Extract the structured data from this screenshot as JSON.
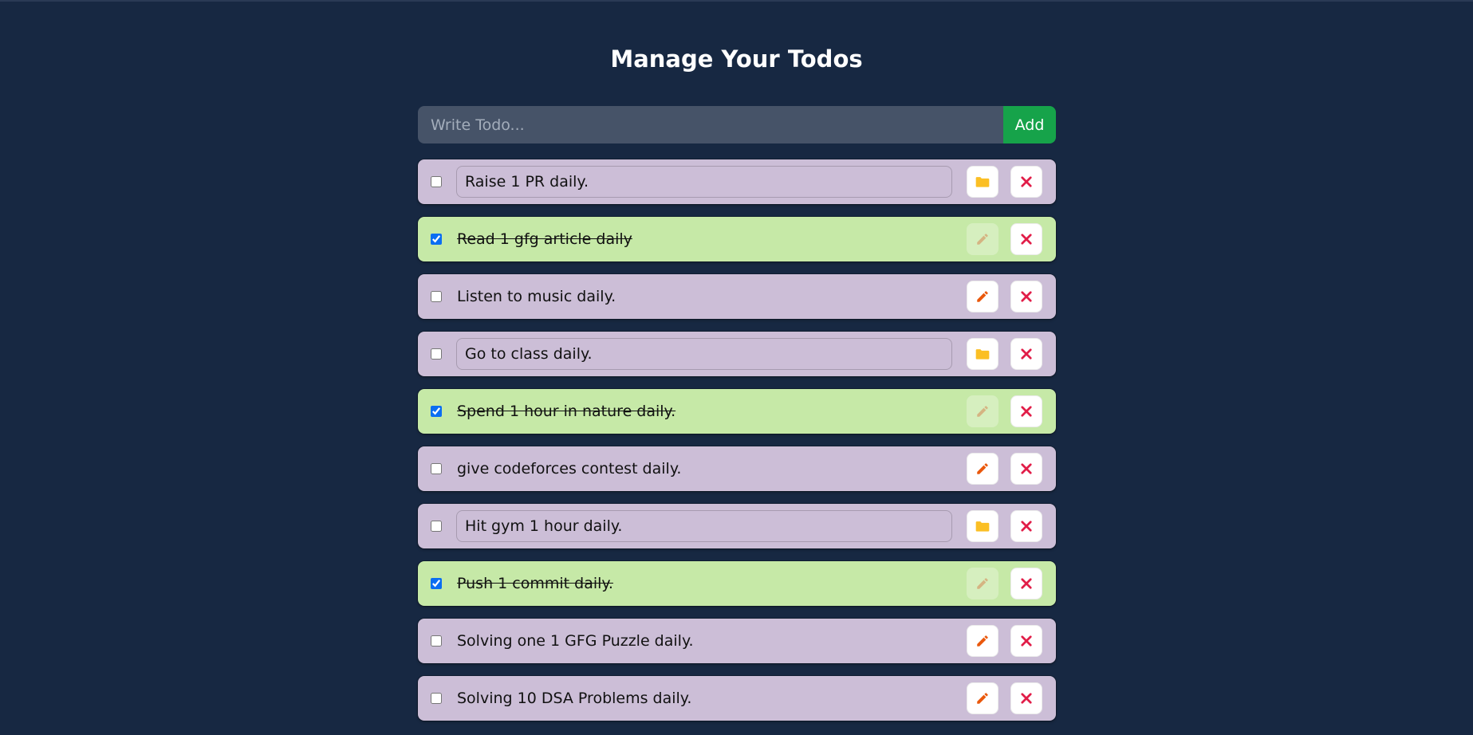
{
  "page": {
    "title": "Manage Your Todos"
  },
  "form": {
    "placeholder": "Write Todo...",
    "value": "",
    "add_label": "Add"
  },
  "colors": {
    "background": "#172842",
    "pending_row": "#ccbed7",
    "completed_row": "#c6e9a7",
    "add_button": "#16a34a",
    "delete_icon": "#e11d48",
    "edit_icon": "#ea580c",
    "save_icon": "#fbbf24"
  },
  "todos": [
    {
      "text": "Raise 1 PR daily.",
      "completed": false,
      "editing": true,
      "action_icon": "folder-icon"
    },
    {
      "text": "Read 1 gfg article daily",
      "completed": true,
      "editing": false,
      "action_icon": "pencil-icon"
    },
    {
      "text": "Listen to music daily.",
      "completed": false,
      "editing": false,
      "action_icon": "pencil-icon"
    },
    {
      "text": "Go to class daily.",
      "completed": false,
      "editing": true,
      "action_icon": "folder-icon"
    },
    {
      "text": "Spend 1 hour in nature daily.",
      "completed": true,
      "editing": false,
      "action_icon": "pencil-icon"
    },
    {
      "text": "give codeforces contest daily.",
      "completed": false,
      "editing": false,
      "action_icon": "pencil-icon"
    },
    {
      "text": "Hit gym 1 hour daily.",
      "completed": false,
      "editing": true,
      "action_icon": "folder-icon"
    },
    {
      "text": "Push 1 commit daily.",
      "completed": true,
      "editing": false,
      "action_icon": "pencil-icon"
    },
    {
      "text": "Solving one 1 GFG Puzzle daily.",
      "completed": false,
      "editing": false,
      "action_icon": "pencil-icon"
    },
    {
      "text": "Solving 10 DSA Problems daily.",
      "completed": false,
      "editing": false,
      "action_icon": "pencil-icon"
    }
  ]
}
